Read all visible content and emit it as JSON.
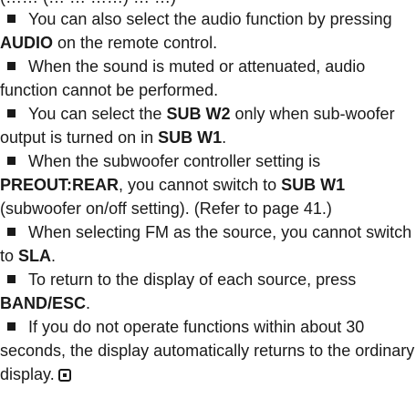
{
  "top_clipped": "(…… (… … ……) … …)",
  "notes": [
    {
      "parts": [
        {
          "t": "You can also select the audio function by pressing "
        },
        {
          "t": "AUDIO",
          "b": true
        },
        {
          "t": " on the remote control."
        }
      ]
    },
    {
      "parts": [
        {
          "t": "When the sound is muted or attenuated, audio function cannot be performed."
        }
      ]
    },
    {
      "parts": [
        {
          "t": "You can select the "
        },
        {
          "t": "SUB W2",
          "b": true
        },
        {
          "t": " only when sub-woofer output is turned on in "
        },
        {
          "t": "SUB W1",
          "b": true
        },
        {
          "t": "."
        }
      ]
    },
    {
      "parts": [
        {
          "t": "When the subwoofer controller setting is "
        },
        {
          "t": "PREOUT:REAR",
          "b": true
        },
        {
          "t": ", you cannot switch to "
        },
        {
          "t": "SUB W1",
          "b": true
        },
        {
          "t": " (subwoofer on/off setting). (Refer to page 41.)"
        }
      ]
    },
    {
      "parts": [
        {
          "t": "When selecting FM as the source, you cannot switch to "
        },
        {
          "t": "SLA",
          "b": true
        },
        {
          "t": "."
        }
      ]
    },
    {
      "parts": [
        {
          "t": "To return to the display of each source, press "
        },
        {
          "t": "BAND/ESC",
          "b": true
        },
        {
          "t": "."
        }
      ]
    },
    {
      "parts": [
        {
          "t": "If you do not operate functions within about 30 seconds, the display automatically returns to the ordinary display."
        }
      ],
      "end_icon": "end-of-section-icon"
    }
  ]
}
